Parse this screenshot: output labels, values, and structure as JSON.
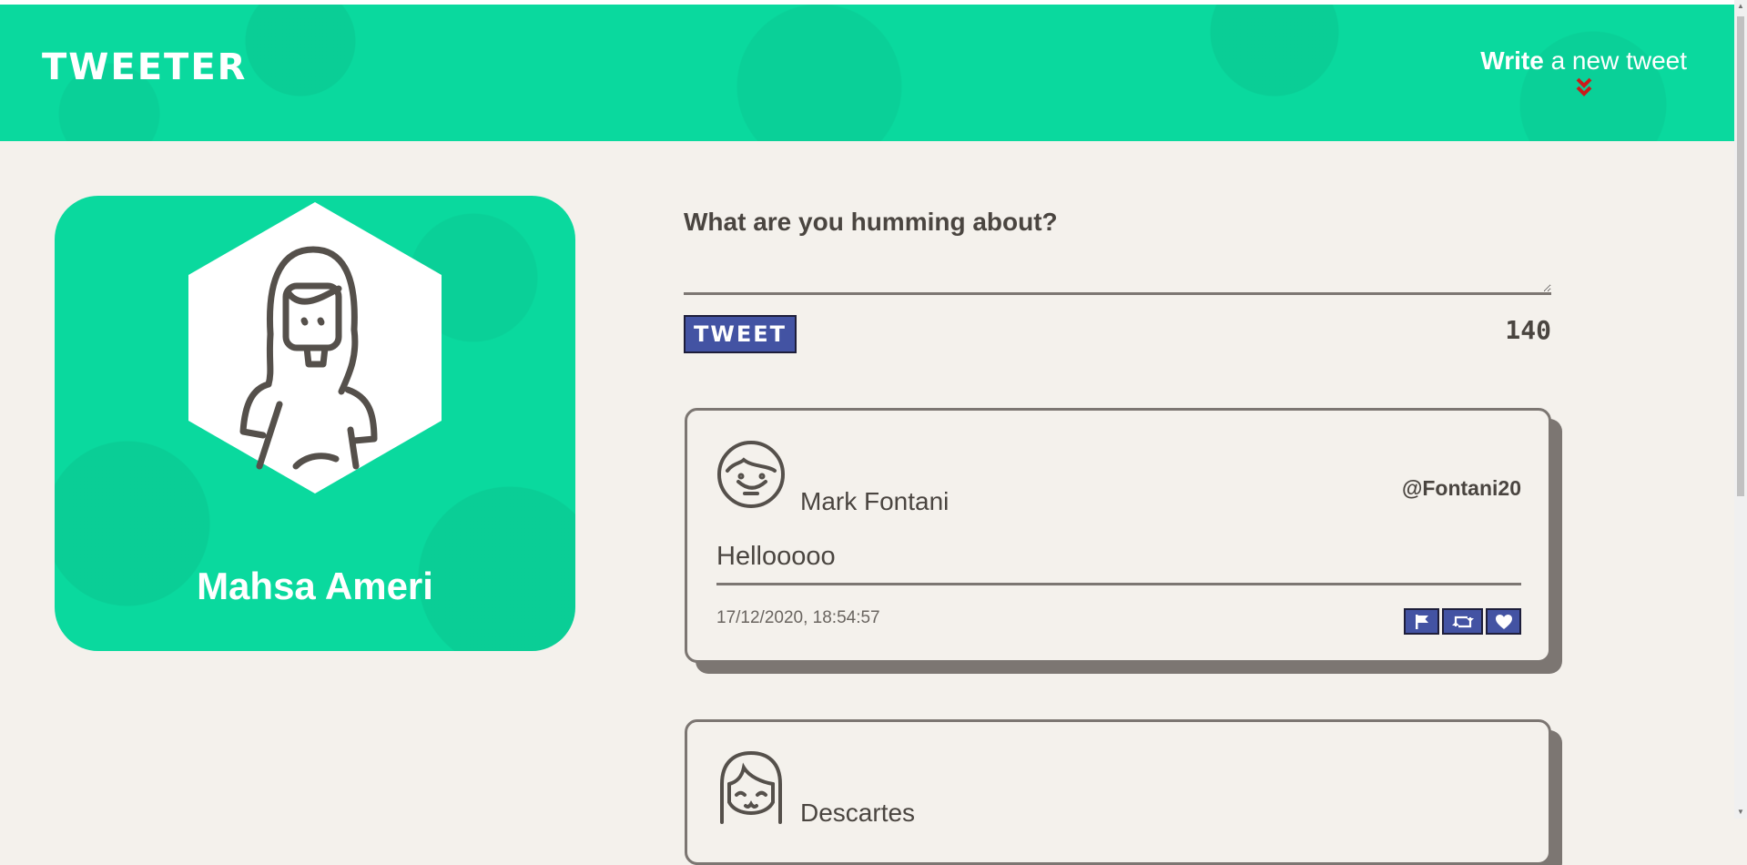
{
  "nav": {
    "brand": "TWEETER",
    "compose_strong": "Write",
    "compose_rest": " a new tweet"
  },
  "profile": {
    "name": "Mahsa Ameri"
  },
  "composer": {
    "label": "What are you humming about?",
    "value": "",
    "button": "TWEET",
    "counter": "140"
  },
  "tweets": [
    {
      "name": "Mark Fontani",
      "handle": "@Fontani20",
      "body": "Hellooooo",
      "timestamp": "17/12/2020, 18:54:57"
    },
    {
      "name": "Descartes"
    }
  ],
  "icons": {
    "compose": "chevron-double-down-icon",
    "actions": [
      "flag-icon",
      "retweet-icon",
      "heart-icon"
    ]
  },
  "colors": {
    "brand_green": "#0ad99e",
    "button_blue": "#4353a3",
    "page_bg": "#f4f1ec",
    "text_dark": "#4a4540",
    "chevron_red": "#cc1b1b"
  }
}
